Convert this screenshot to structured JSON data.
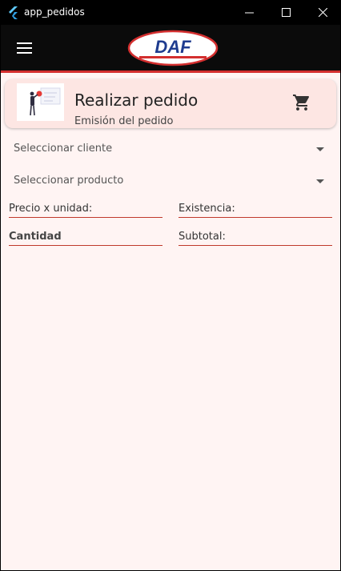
{
  "window": {
    "title": "app_pedidos",
    "controls": [
      "minimize",
      "maximize",
      "close"
    ]
  },
  "appbar": {
    "menu_icon": "hamburger-menu-icon",
    "logo_text": "DAF",
    "accent_color": "#d32f2f"
  },
  "header_card": {
    "title": "Realizar pedido",
    "subtitle": "Emisión del pedido",
    "icon": "shopping-cart-icon"
  },
  "form": {
    "client_select": {
      "label": "Seleccionar cliente"
    },
    "product_select": {
      "label": "Seleccionar producto"
    },
    "price_label": "Precio x unidad:",
    "stock_label": "Existencia:",
    "quantity_label": "Cantidad",
    "subtotal_label": "Subtotal:"
  },
  "colors": {
    "background": "#fff4f3",
    "card": "#fde6e3",
    "field_underline": "#c0392b"
  }
}
